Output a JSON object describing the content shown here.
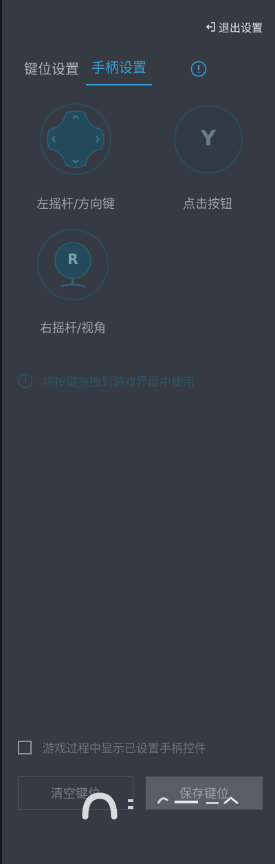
{
  "header": {
    "exit_label": "退出设置",
    "exit_icon": "exit-icon"
  },
  "tabs": [
    {
      "label": "键位设置",
      "active": false
    },
    {
      "label": "手柄设置",
      "active": true
    }
  ],
  "controls": {
    "left_stick": {
      "label": "左摇杆/方向键",
      "icon": "dpad-icon"
    },
    "button": {
      "label": "点击按钮",
      "glyph": "Y",
      "icon": "y-button-icon"
    },
    "right_stick": {
      "label": "右摇杆/视角",
      "glyph": "R",
      "icon": "joystick-icon"
    }
  },
  "hint": {
    "text": "将按键拖拽到游戏界面中使用"
  },
  "options": {
    "show_controls_label": "游戏过程中显示已设置手柄控件",
    "show_controls_checked": false
  },
  "actions": {
    "clear_label": "清空键位",
    "save_label": "保存键位"
  },
  "colors": {
    "panel_bg": "#363a43",
    "accent": "#2fa3d8",
    "widget_ring": "#274d5e"
  }
}
